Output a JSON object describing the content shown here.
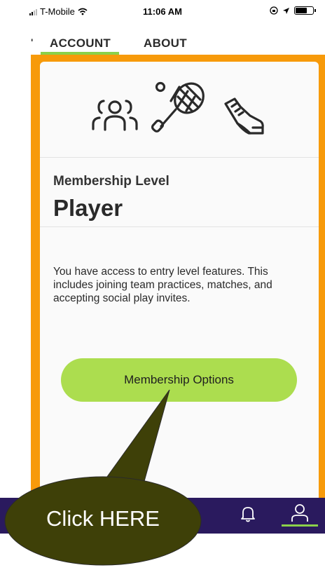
{
  "status_bar": {
    "carrier": "T-Mobile",
    "time": "11:06 AM"
  },
  "tabs": [
    {
      "label": "ACCOUNT",
      "active": true
    },
    {
      "label": "ABOUT",
      "active": false
    }
  ],
  "card": {
    "icons": [
      "people-icon",
      "tennis-racket-icon",
      "sneaker-icon"
    ],
    "membership_label": "Membership Level",
    "membership_value": "Player",
    "description": "You have access to entry level features. This includes joining team practices, matches, and accepting social play invites.",
    "button_label": "Membership Options"
  },
  "bottom_nav": {
    "items": [
      "bell-icon",
      "person-icon"
    ],
    "active": "person-icon"
  },
  "annotation": {
    "text": "Click HERE"
  },
  "colors": {
    "frame": "#f79a0a",
    "accent": "#8bd14a",
    "button": "#acdd4f",
    "nav": "#2a1a5e",
    "callout": "#3e4008"
  }
}
